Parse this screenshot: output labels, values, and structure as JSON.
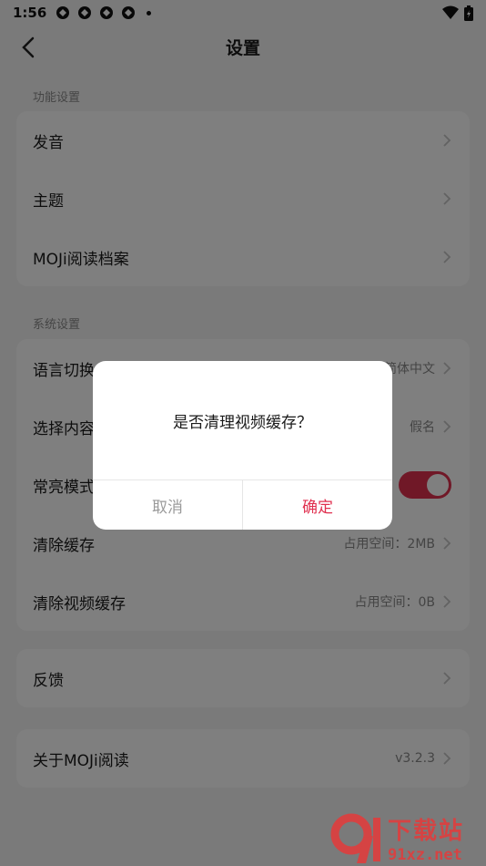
{
  "status_bar": {
    "time": "1:56"
  },
  "nav": {
    "title": "设置"
  },
  "sections": [
    {
      "label": "功能设置",
      "rows": [
        {
          "label": "发音",
          "value": ""
        },
        {
          "label": "主题",
          "value": ""
        },
        {
          "label": "MOJi阅读档案",
          "value": ""
        }
      ]
    },
    {
      "label": "系统设置",
      "rows": [
        {
          "label": "语言切换",
          "value": "简体中文"
        },
        {
          "label": "选择内容",
          "value": "假名"
        },
        {
          "label": "常亮模式",
          "value": "",
          "toggle_on": true
        },
        {
          "label": "清除缓存",
          "value": "占用空间：2MB"
        },
        {
          "label": "清除视频缓存",
          "value": "占用空间：0B"
        }
      ]
    }
  ],
  "feedback": {
    "label": "反馈"
  },
  "about": {
    "label": "关于MOJi阅读",
    "version": "v3.2.3"
  },
  "dialog": {
    "message": "是否清理视频缓存？",
    "cancel_label": "取消",
    "confirm_label": "确定"
  },
  "watermark": {
    "top": "下载站",
    "bottom": "91xz.net"
  },
  "colors": {
    "accent": "#e0304f",
    "background": "#f4f4f4"
  }
}
